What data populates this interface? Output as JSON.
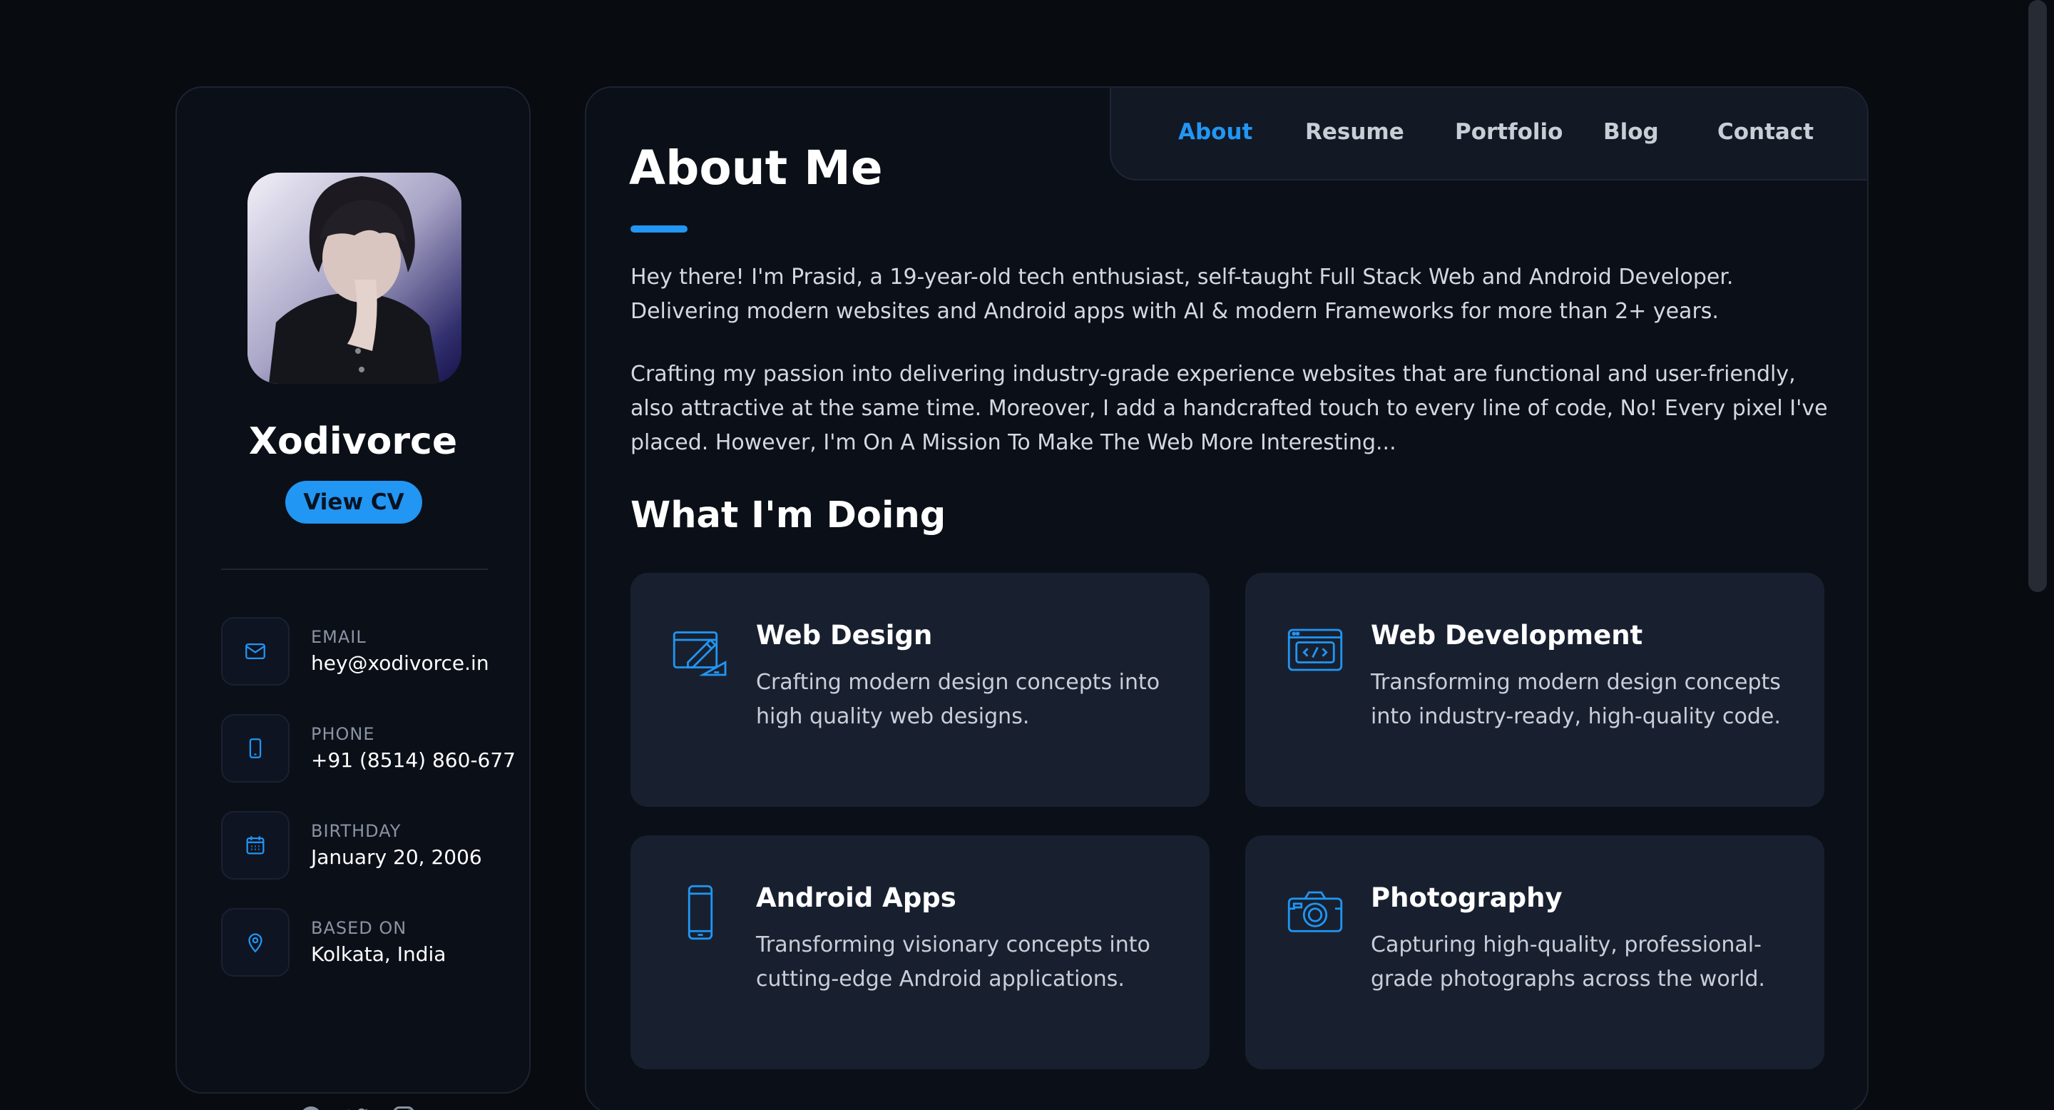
{
  "profile": {
    "name": "Xodivorce",
    "cv_button": "View CV"
  },
  "contacts": [
    {
      "label": "EMAIL",
      "value": "hey@xodivorce.in",
      "icon": "mail-icon"
    },
    {
      "label": "PHONE",
      "value": "+91 (8514) 860-677",
      "icon": "phone-icon"
    },
    {
      "label": "BIRTHDAY",
      "value": "January 20, 2006",
      "icon": "calendar-icon"
    },
    {
      "label": "BASED ON",
      "value": "Kolkata, India",
      "icon": "location-pin-icon"
    }
  ],
  "socials": [
    "facebook-icon",
    "twitter-icon",
    "instagram-icon"
  ],
  "nav": {
    "items": [
      "About",
      "Resume",
      "Portfolio",
      "Blog",
      "Contact"
    ],
    "active": "About"
  },
  "about": {
    "title": "About Me",
    "paragraphs": [
      "Hey there! I'm Prasid, a 19-year-old tech enthusiast, self-taught Full Stack Web and Android Developer. Delivering modern websites and Android apps with AI & modern Frameworks for more than 2+ years.",
      "Crafting my passion into delivering industry-grade experience websites that are functional and user-friendly, also attractive at the same time. Moreover, I add a handcrafted touch to every line of code, No! Every pixel I've placed. However, I'm On A Mission To Make The Web More Interesting..."
    ]
  },
  "services": {
    "title": "What I'm Doing",
    "items": [
      {
        "title": "Web Design",
        "text": "Crafting modern design concepts into high quality web designs.",
        "icon": "web-design-icon"
      },
      {
        "title": "Web Development",
        "text": "Transforming modern design concepts into industry-ready, high-quality code.",
        "icon": "code-window-icon"
      },
      {
        "title": "Android Apps",
        "text": "Transforming visionary concepts into cutting-edge Android applications.",
        "icon": "smartphone-icon"
      },
      {
        "title": "Photography",
        "text": "Capturing high-quality, professional-grade photographs across the world.",
        "icon": "camera-icon"
      }
    ]
  },
  "colors": {
    "accent": "#2196f3",
    "background": "#080b10",
    "card": "#182030"
  }
}
